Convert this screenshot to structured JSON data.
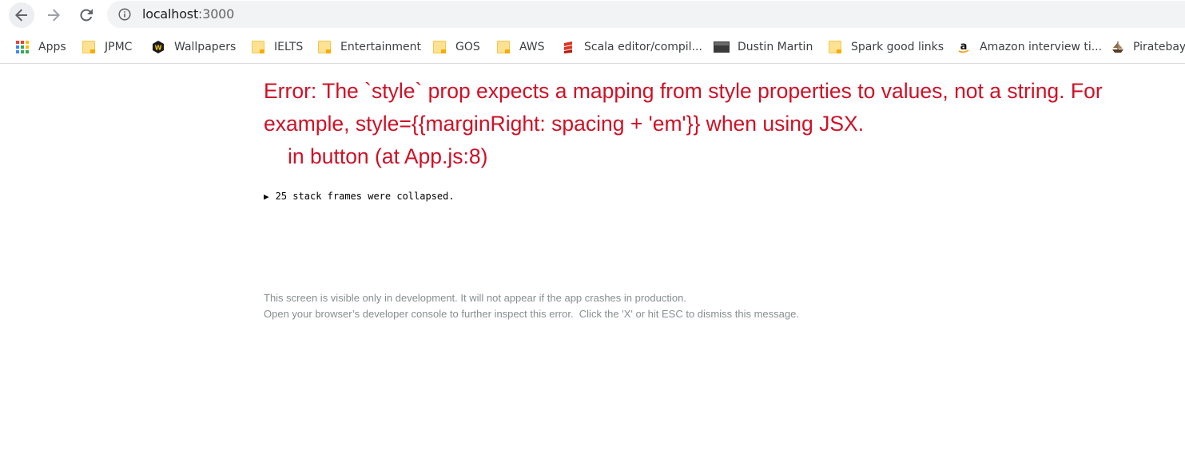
{
  "browser": {
    "url_host": "localhost",
    "url_port": ":3000",
    "bookmarks": [
      {
        "label": "Apps",
        "icon": "apps-grid-icon"
      },
      {
        "label": "JPMC",
        "icon": "folder-icon"
      },
      {
        "label": "Wallpapers",
        "icon": "wallpapers-site-icon"
      },
      {
        "label": "IELTS",
        "icon": "folder-icon"
      },
      {
        "label": "Entertainment",
        "icon": "folder-icon"
      },
      {
        "label": "GOS",
        "icon": "folder-icon"
      },
      {
        "label": "AWS",
        "icon": "folder-icon"
      },
      {
        "label": "Scala editor/compil...",
        "icon": "scala-icon"
      },
      {
        "label": "Dustin Martin",
        "icon": "page-thumbnail-icon"
      },
      {
        "label": "Spark good links",
        "icon": "folder-icon"
      },
      {
        "label": "Amazon interview ti...",
        "icon": "amazon-icon"
      },
      {
        "label": "Piratebay",
        "icon": "piratebay-icon"
      }
    ]
  },
  "error": {
    "message": "Error: The `style` prop expects a mapping from style properties to values, not a string. For example, style={{marginRight: spacing + 'em'}} when using JSX.",
    "location": "in button (at App.js:8)",
    "collapsed_frames": "25 stack frames were collapsed.",
    "footer_line1": "This screen is visible only in development. It will not appear if the app crashes in production.",
    "footer_line2": "Open your browser’s developer console to further inspect this error.  Click the 'X' or hit ESC to dismiss this message."
  },
  "colors": {
    "error_red": "#ce1126",
    "footer_gray": "#878e91",
    "folder_yellow": "#fde293"
  }
}
